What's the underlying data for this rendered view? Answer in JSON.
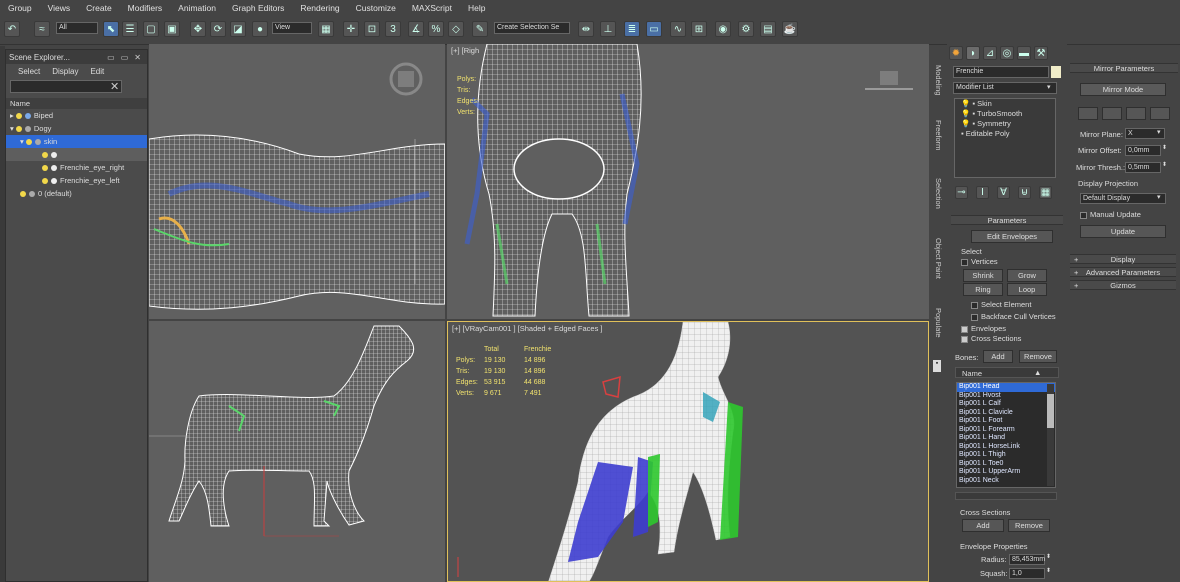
{
  "menu": [
    "Group",
    "Views",
    "Create",
    "Modifiers",
    "Animation",
    "Graph Editors",
    "Rendering",
    "Customize",
    "MAXScript",
    "Help"
  ],
  "toolbar": {
    "filter_select": "All",
    "view_select": "View",
    "selection_set": "Create Selection Se"
  },
  "explorer": {
    "title": "Scene Explorer...",
    "menu": [
      "Select",
      "Display",
      "Edit"
    ],
    "col_name": "Name",
    "items": [
      {
        "label": "Biped"
      },
      {
        "label": "Dogy"
      },
      {
        "label": "skin"
      },
      {
        "label": ""
      },
      {
        "label": "Frenchie_eye_right"
      },
      {
        "label": "Frenchie_eye_left"
      },
      {
        "label": "0 (default)"
      }
    ]
  },
  "viewports": {
    "top_right_label": "[+] [Righ",
    "top_right_stats": [
      "Polys:",
      "Tris:",
      "Edges:",
      "Verts:"
    ],
    "bottom_right_label": "[+] [VRayCam001 ] [Shaded + Edged Faces ]",
    "stats": {
      "headers": [
        "Total",
        "Frenchie"
      ],
      "rows": [
        [
          "Polys:",
          "19 130",
          "14 896"
        ],
        [
          "Tris:",
          "19 130",
          "14 896"
        ],
        [
          "Edges:",
          "53 915",
          "44 688"
        ],
        [
          "Verts:",
          "9 671",
          "7 491"
        ]
      ]
    }
  },
  "side_tabs": [
    "Modeling",
    "Freeform",
    "Selection",
    "Object Paint",
    "Populate"
  ],
  "command": {
    "object_name": "Frenchie",
    "modifier_list": "Modifier List",
    "stack": [
      "Skin",
      "TurboSmooth",
      "Symmetry",
      "Editable Poly"
    ],
    "parameters": "Parameters",
    "edit_envelopes": "Edit Envelopes",
    "select": "Select",
    "vertices": "Vertices",
    "shrink": "Shrink",
    "grow": "Grow",
    "ring": "Ring",
    "loop": "Loop",
    "select_element": "Select Element",
    "backface": "Backface Cull Vertices",
    "envelopes": "Envelopes",
    "cross_sections": "Cross Sections",
    "bones_label": "Bones:",
    "add": "Add",
    "remove": "Remove",
    "name_col": "Name",
    "bones": [
      "Bip001 Head",
      "Bip001 Hvost",
      "Bip001 L Calf",
      "Bip001 L Clavicle",
      "Bip001 L Foot",
      "Bip001 L Forearm",
      "Bip001 L Hand",
      "Bip001 L HorseLink",
      "Bip001 L Thigh",
      "Bip001 L Toe0",
      "Bip001 L UpperArm",
      "Bip001 Neck"
    ],
    "cross_sections_group": "Cross Sections",
    "cs_add": "Add",
    "cs_remove": "Remove",
    "envelope_props": "Envelope Properties",
    "radius_label": "Radius:",
    "radius_value": "85,453mm",
    "squash_label": "Squash:",
    "squash_value": "1,0"
  },
  "mirror": {
    "title": "Mirror Parameters",
    "mode": "Mirror Mode",
    "plane_label": "Mirror Plane:",
    "plane_value": "X",
    "offset_label": "Mirror Offset:",
    "offset_value": "0,0mm",
    "thresh_label": "Mirror Thresh.:",
    "thresh_value": "0,5mm",
    "display_proj": "Display Projection",
    "display_value": "Default Display",
    "manual": "Manual Update",
    "update": "Update",
    "rollouts": [
      "Display",
      "Advanced Parameters",
      "Gizmos"
    ]
  }
}
